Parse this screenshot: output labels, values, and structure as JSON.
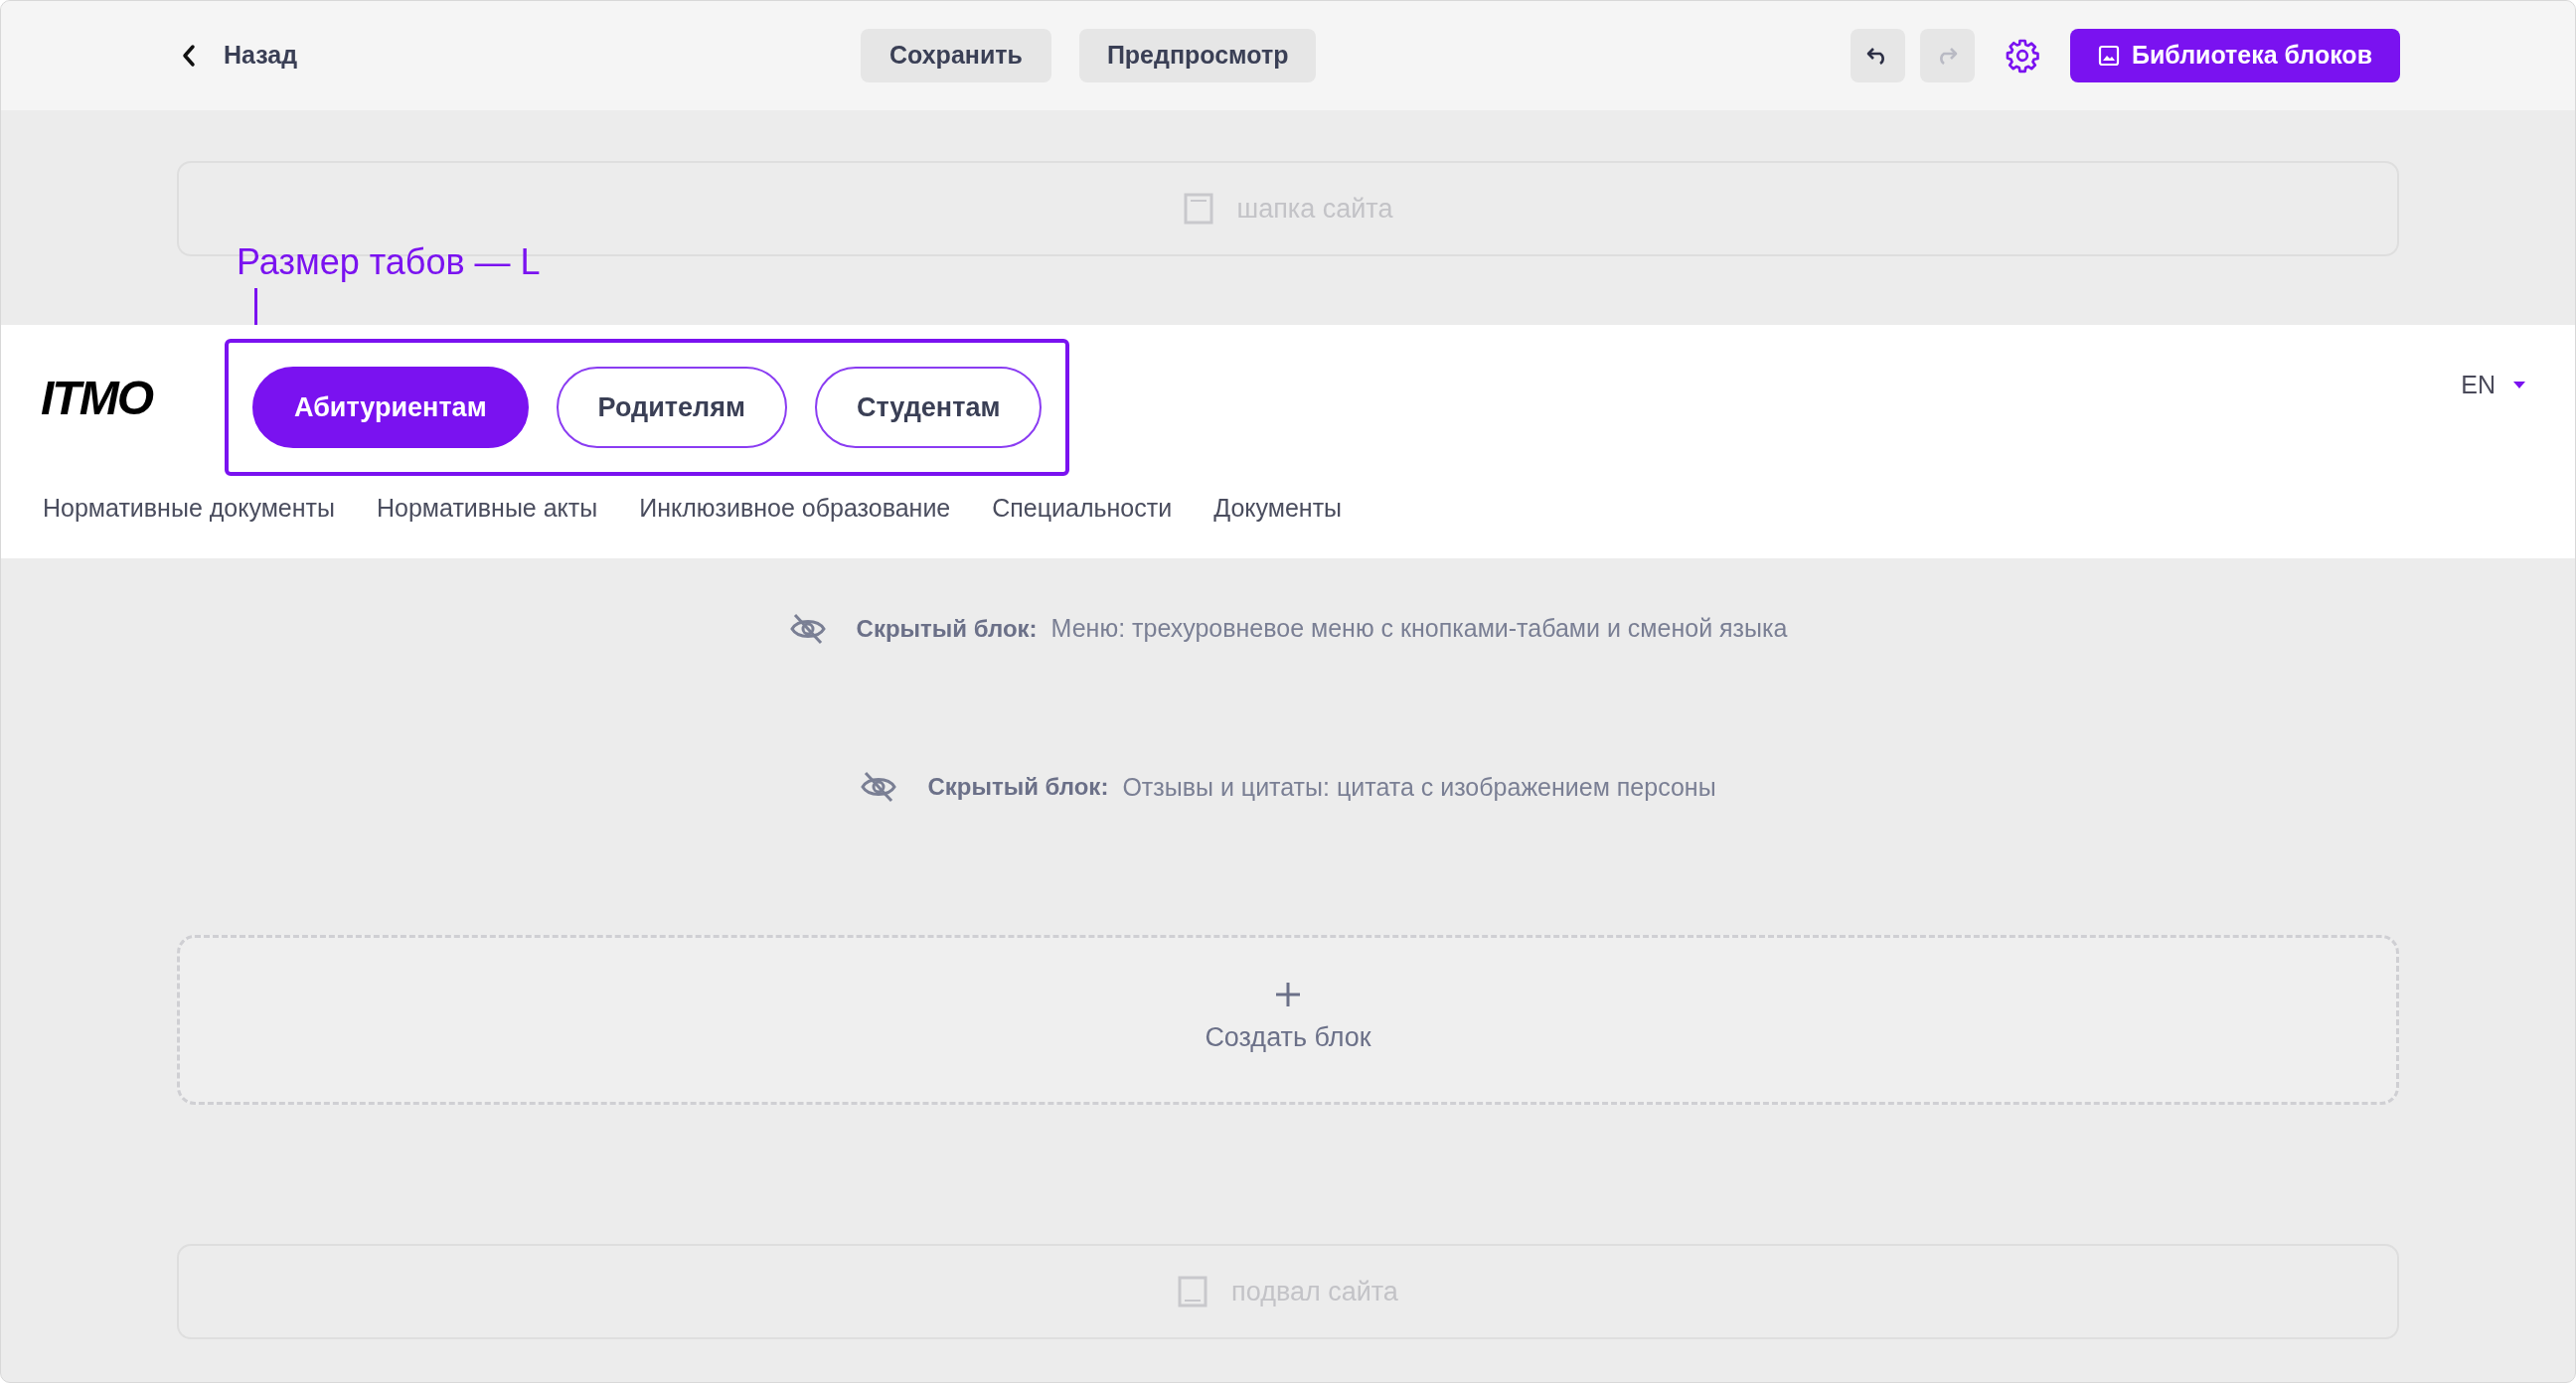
{
  "toolbar": {
    "back": "Назад",
    "save": "Сохранить",
    "preview": "Предпросмотр",
    "undo": {
      "disabled": false
    },
    "redo": {
      "disabled": true
    },
    "library": "Библиотека блоков"
  },
  "site_header_placeholder": "шапка сайта",
  "annotation": "Размер табов — L",
  "menu_block": {
    "logo": "ITMO",
    "tabs": [
      {
        "label": "Абитуриентам",
        "selected": true
      },
      {
        "label": "Родителям",
        "selected": false
      },
      {
        "label": "Студентам",
        "selected": false
      }
    ],
    "language": "EN",
    "links": [
      "Нормативные документы",
      "Нормативные акты",
      "Инклюзивное образование",
      "Специальности",
      "Документы"
    ]
  },
  "hidden_blocks": [
    {
      "label": "Скрытый блок:",
      "description": "Меню: трехуровневое меню с кнопками-табами и сменой языка"
    },
    {
      "label": "Скрытый блок:",
      "description": "Отзывы и цитаты: цитата с изображением персоны"
    }
  ],
  "create_block": "Создать блок",
  "site_footer_placeholder": "подвал сайта"
}
